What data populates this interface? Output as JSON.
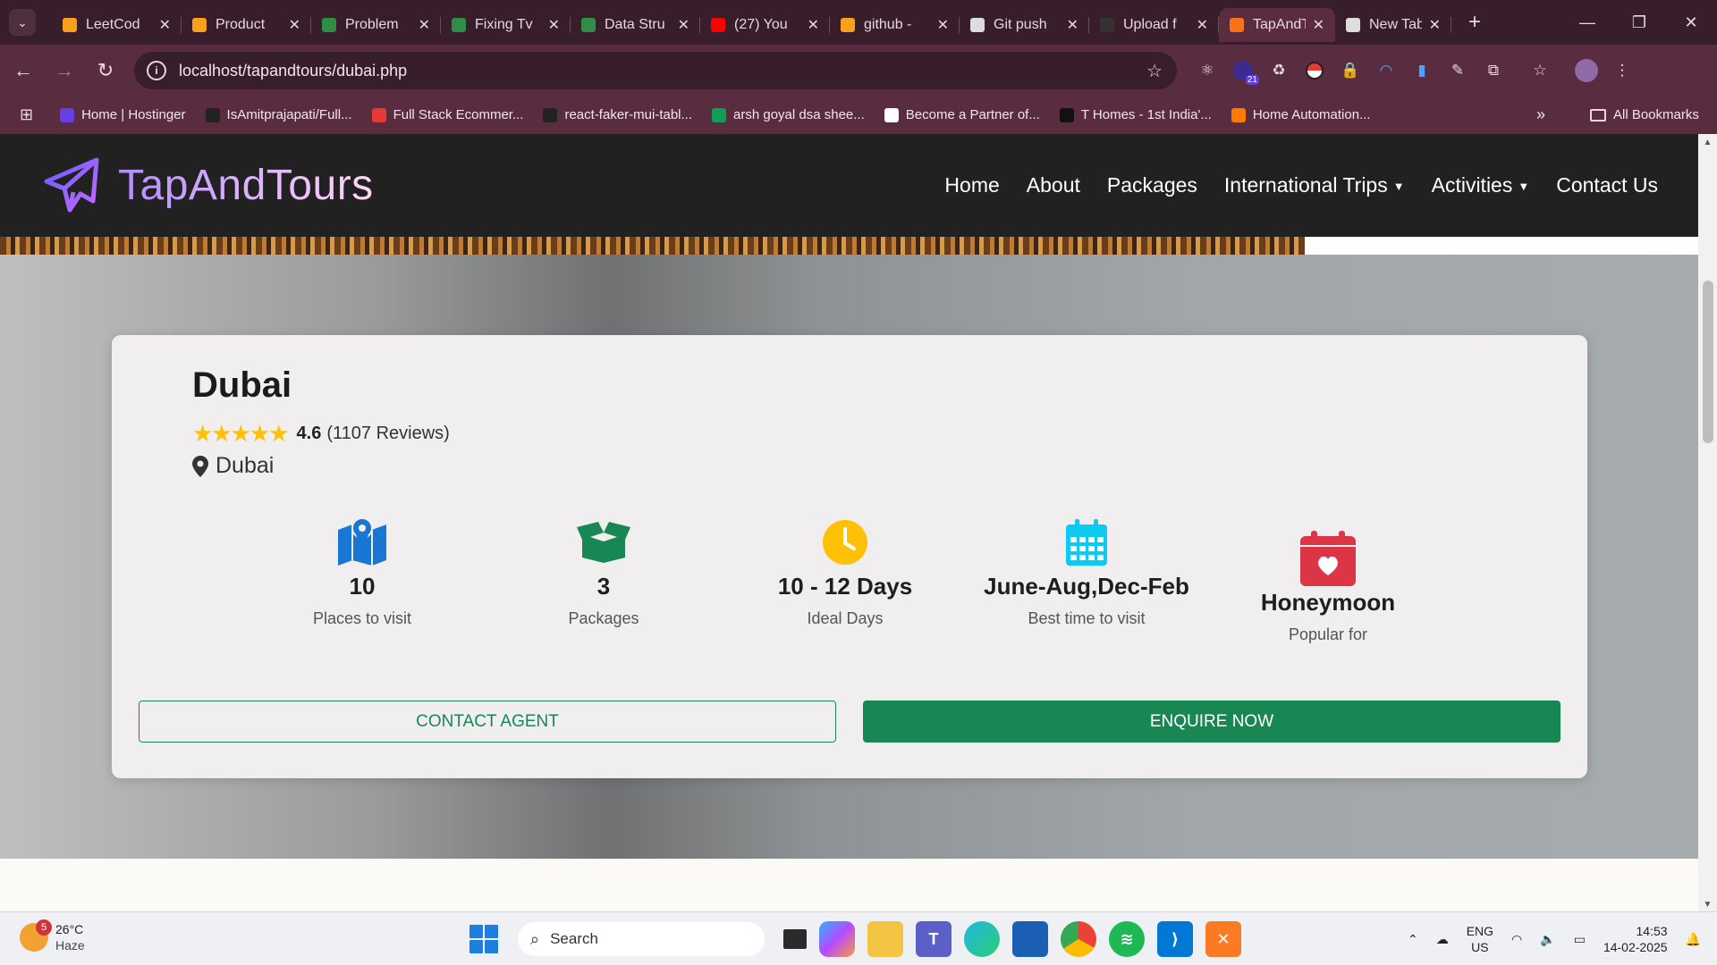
{
  "browser": {
    "tabs": [
      {
        "title": "LeetCod",
        "favicon_color": "#f89f1b"
      },
      {
        "title": "Product",
        "favicon_color": "#f89f1b"
      },
      {
        "title": "Problem",
        "favicon_color": "#2f8d46"
      },
      {
        "title": "Fixing Tv",
        "favicon_color": "#2f8d46"
      },
      {
        "title": "Data Stru",
        "favicon_color": "#2f8d46"
      },
      {
        "title": "(27) You",
        "favicon_color": "#ff0000"
      },
      {
        "title": "github -",
        "favicon_color": "#f89f1b"
      },
      {
        "title": "Git push",
        "favicon_color": "#dddddd"
      },
      {
        "title": "Upload f",
        "favicon_color": "#333333"
      },
      {
        "title": "TapAndT",
        "favicon_color": "#f97316",
        "active": true
      },
      {
        "title": "New Tab",
        "favicon_color": "#dddddd"
      }
    ],
    "url": "localhost/tapandtours/dubai.php",
    "extension_badge": "21",
    "bookmarks": [
      {
        "label": "Home | Hostinger",
        "color": "#673de6"
      },
      {
        "label": "IsAmitprajapati/Full...",
        "color": "#222222"
      },
      {
        "label": "Full Stack Ecommer...",
        "color": "#e53935"
      },
      {
        "label": "react-faker-mui-tabl...",
        "color": "#222222"
      },
      {
        "label": "arsh goyal dsa shee...",
        "color": "#0f9d58"
      },
      {
        "label": "Become a Partner of...",
        "color": "#ffffff"
      },
      {
        "label": "T Homes - 1st India'...",
        "color": "#111111"
      },
      {
        "label": "Home Automation...",
        "color": "#ff7a00"
      }
    ],
    "all_bookmarks_label": "All Bookmarks"
  },
  "site": {
    "brand": "TapAndTours",
    "nav": [
      {
        "label": "Home"
      },
      {
        "label": "About"
      },
      {
        "label": "Packages"
      },
      {
        "label": "International Trips",
        "dropdown": true
      },
      {
        "label": "Activities",
        "dropdown": true
      },
      {
        "label": "Contact Us"
      }
    ]
  },
  "destination": {
    "name": "Dubai",
    "rating": "4.6",
    "rating_stars": 5,
    "reviews": "(1107 Reviews)",
    "location": "Dubai",
    "stats": [
      {
        "value": "10",
        "label": "Places to visit",
        "icon": "map-pin-icon",
        "color": "#1976d2"
      },
      {
        "value": "3",
        "label": "Packages",
        "icon": "box-open-icon",
        "color": "#198754"
      },
      {
        "value": "10 - 12 Days",
        "label": "Ideal Days",
        "icon": "clock-icon",
        "color": "#ffc107"
      },
      {
        "value": "June-Aug,Dec-Feb",
        "label": "Best time to visit",
        "icon": "calendar-icon",
        "color": "#0dcaf0"
      },
      {
        "value": "Honeymoon",
        "label": "Popular for",
        "icon": "calendar-heart-icon",
        "color": "#dc3545"
      }
    ],
    "contact_button": "CONTACT AGENT",
    "enquire_button": "ENQUIRE NOW"
  },
  "taskbar": {
    "weather_temp": "26°C",
    "weather_desc": "Haze",
    "weather_badge": "5",
    "search_placeholder": "Search",
    "lang_top": "ENG",
    "lang_bottom": "US",
    "time": "14:53",
    "date": "14-02-2025"
  }
}
